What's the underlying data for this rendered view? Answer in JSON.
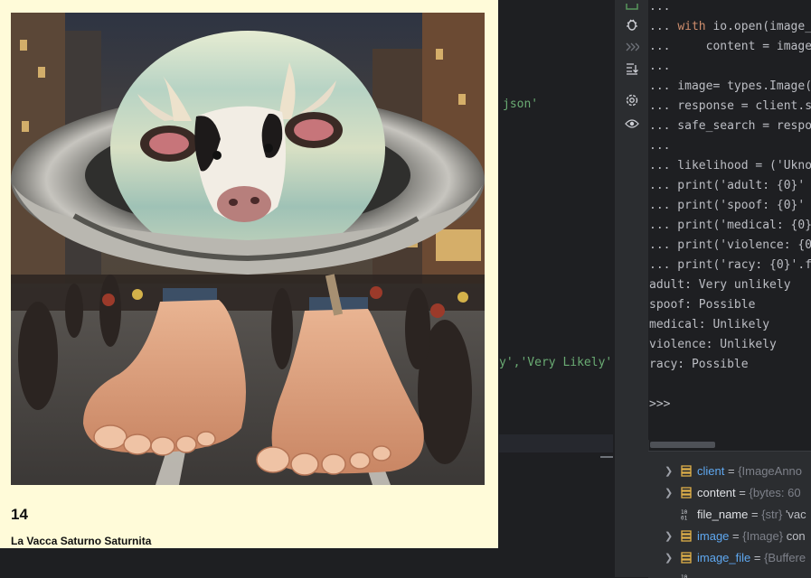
{
  "card": {
    "number": "14",
    "title": "La Vacca Saturno Saturnita"
  },
  "editor": {
    "fragment_json": "json'",
    "fragment_likely": "y','Very Likely')"
  },
  "console": {
    "lines": [
      {
        "prompt": "...",
        "text": ""
      },
      {
        "prompt": "...",
        "kw": "with",
        "text": " io.open(image_"
      },
      {
        "prompt": "...",
        "text": "     content = image"
      },
      {
        "prompt": "...",
        "text": ""
      },
      {
        "prompt": "...",
        "text": " image= types.Image("
      },
      {
        "prompt": "...",
        "text": " response = client.s"
      },
      {
        "prompt": "...",
        "text": " safe_search = respo"
      },
      {
        "prompt": "...",
        "text": ""
      },
      {
        "prompt": "...",
        "text": " likelihood = ('Ukno"
      },
      {
        "prompt": "...",
        "text": " print('adult: {0}'"
      },
      {
        "prompt": "...",
        "text": " print('spoof: {0}'"
      },
      {
        "prompt": "...",
        "text": " print('medical: {0}"
      },
      {
        "prompt": "...",
        "text": " print('violence: {0"
      },
      {
        "prompt": "...",
        "text": " print('racy: {0}'.f"
      }
    ],
    "output": [
      "adult: Very unlikely",
      "spoof: Possible",
      "medical: Unlikely",
      "violence: Unlikely",
      "racy: Possible"
    ],
    "prompt": ">>>"
  },
  "variables": [
    {
      "name": "client",
      "type": "{ImageAnno",
      "value": "",
      "expandable": true,
      "icon": "object-icon"
    },
    {
      "name": "content",
      "type": "{bytes: 60",
      "value": "",
      "expandable": true,
      "icon": "object-icon"
    },
    {
      "name": "file_name",
      "type": "{str}",
      "value": "'vac",
      "expandable": false,
      "icon": "string-icon"
    },
    {
      "name": "image",
      "type": "{Image}",
      "value": "con",
      "expandable": true,
      "icon": "object-icon"
    },
    {
      "name": "image_file",
      "type": "{Buffere",
      "value": "",
      "expandable": true,
      "icon": "object-icon"
    }
  ],
  "toolstrip": [
    "python-console-icon",
    "debug-icon",
    "rerun-icon",
    "scroll-to-end-icon",
    "settings-icon",
    "view-icon"
  ],
  "colors": {
    "card_bg": "#fffbd9",
    "ide_bg": "#1e1f22",
    "keyword": "#cf8e6d",
    "string": "#6aab73",
    "var_name": "#5fa8f0"
  }
}
